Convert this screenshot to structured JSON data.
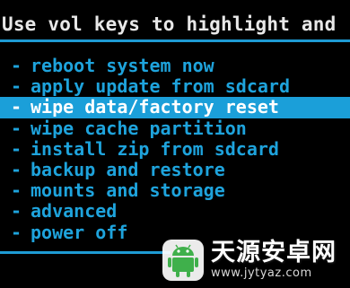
{
  "header": {
    "instruction": "Use vol keys to highlight and"
  },
  "menu": {
    "items": [
      {
        "label": "reboot system now",
        "selected": false
      },
      {
        "label": "apply update from sdcard",
        "selected": false
      },
      {
        "label": "wipe data/factory reset",
        "selected": true
      },
      {
        "label": "wipe cache partition",
        "selected": false
      },
      {
        "label": "install zip from sdcard",
        "selected": false
      },
      {
        "label": "backup and restore",
        "selected": false
      },
      {
        "label": "mounts and storage",
        "selected": false
      },
      {
        "label": "advanced",
        "selected": false
      },
      {
        "label": "power off",
        "selected": false
      }
    ],
    "bullet": "-"
  },
  "watermark": {
    "title": "天源安卓网",
    "url": "www.jytyaz.com"
  },
  "colors": {
    "accent": "#1ea3dc",
    "highlight": "#1b9fd9",
    "background": "#000000"
  }
}
